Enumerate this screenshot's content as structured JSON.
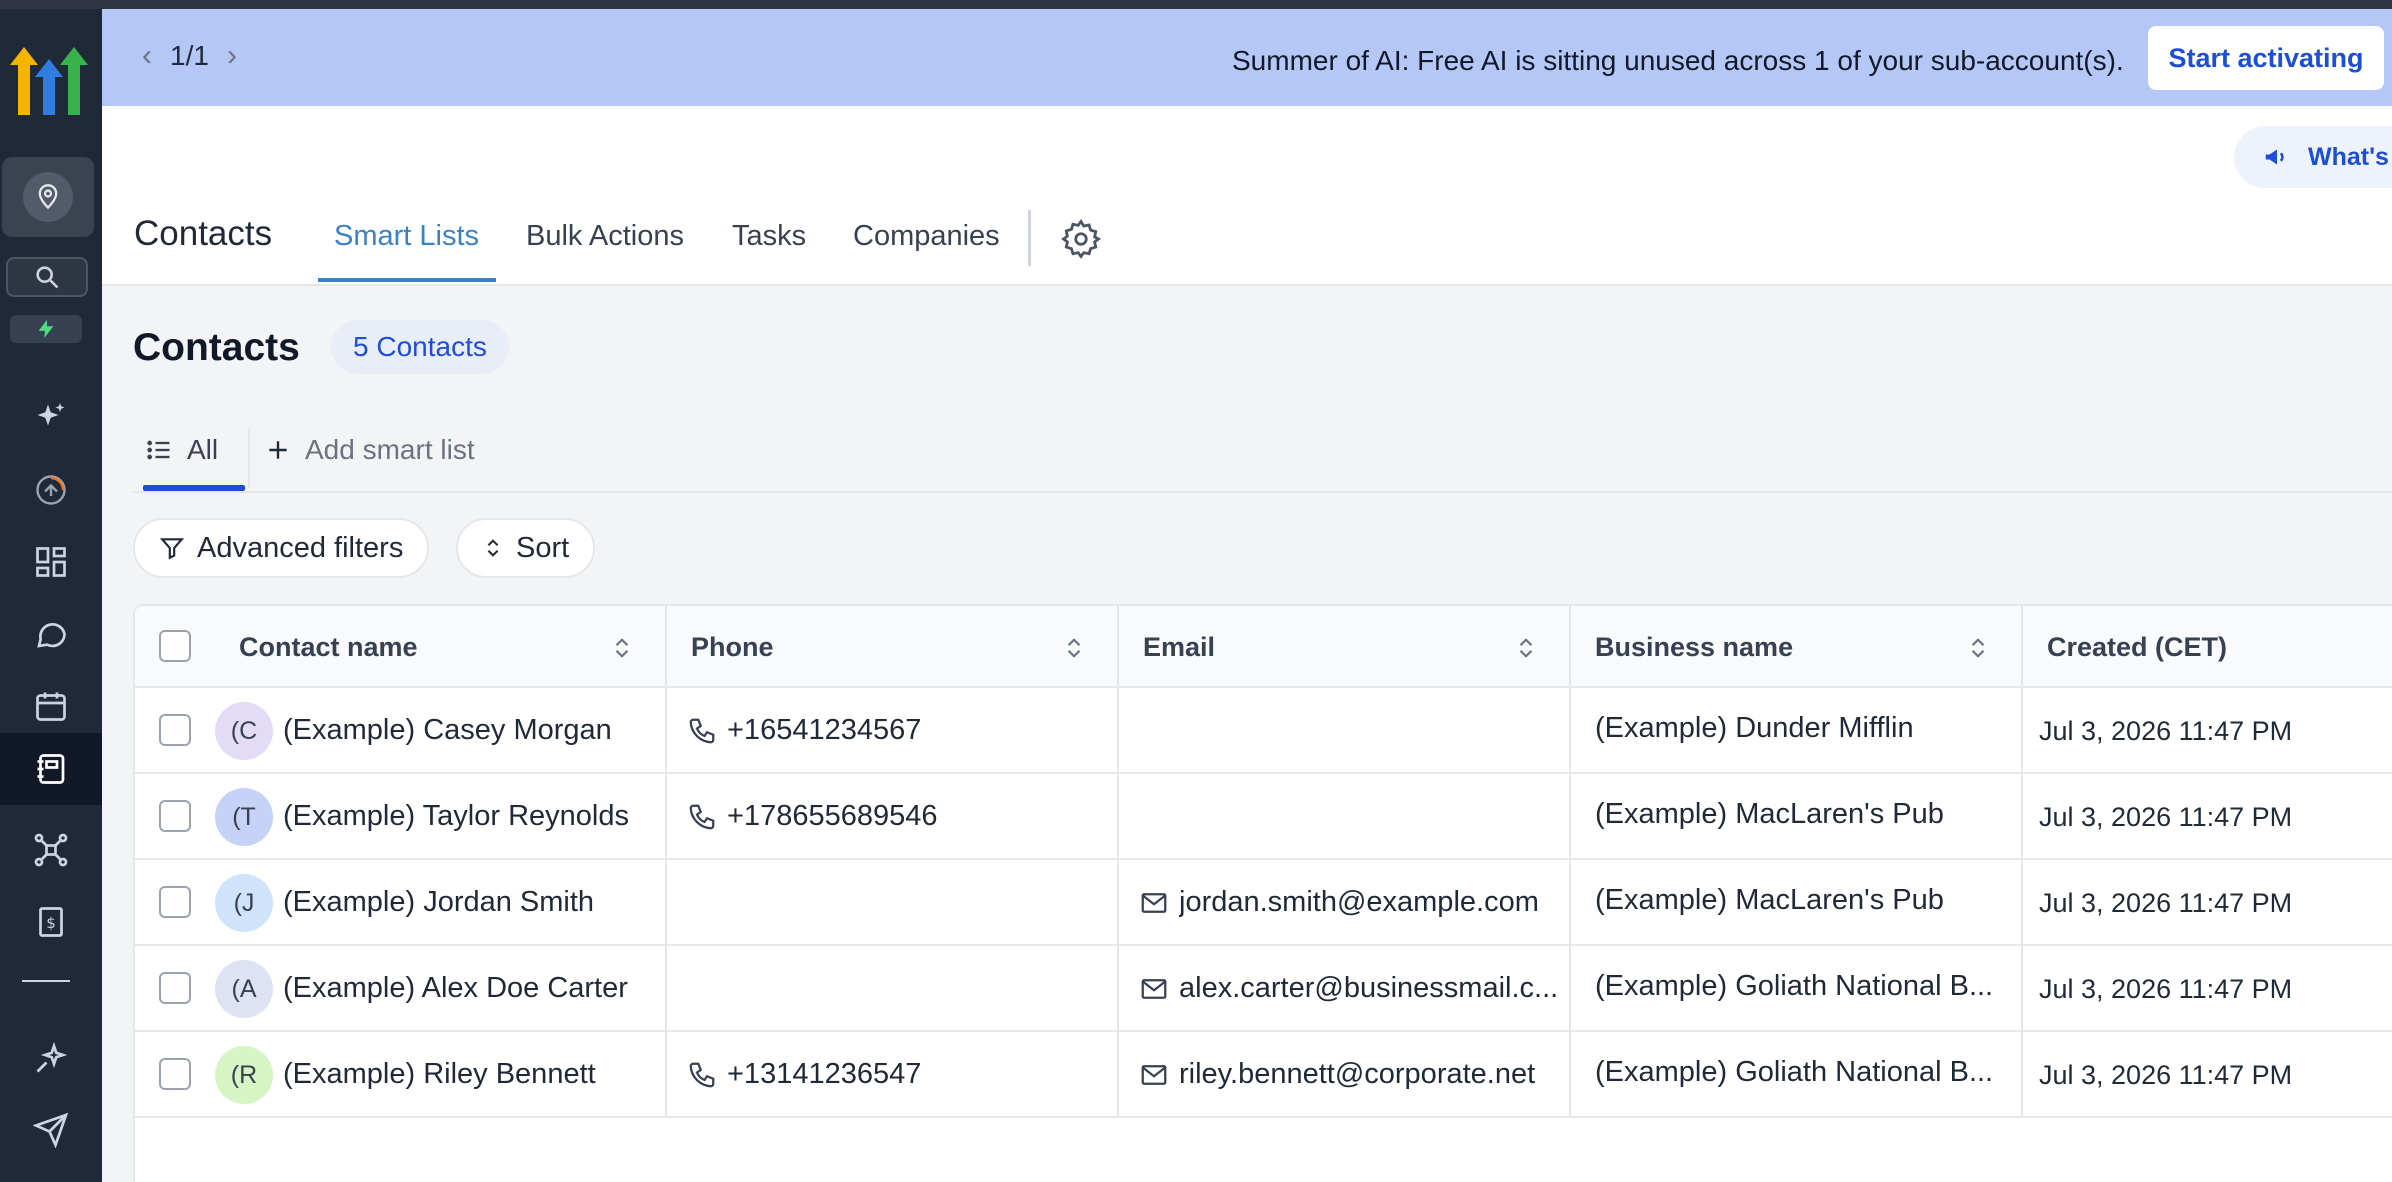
{
  "banner": {
    "pager_text": "1/1",
    "message": "Summer of AI: Free AI is sitting unused across 1 of your sub-account(s).",
    "cta_label": "Start activating"
  },
  "header": {
    "whats_new_label": "What's",
    "title": "Contacts",
    "tabs": [
      {
        "label": "Smart Lists",
        "active": true
      },
      {
        "label": "Bulk Actions",
        "active": false
      },
      {
        "label": "Tasks",
        "active": false
      },
      {
        "label": "Companies",
        "active": false
      }
    ]
  },
  "section": {
    "title": "Contacts",
    "count_badge": "5 Contacts"
  },
  "smart_lists": {
    "all_label": "All",
    "add_label": "Add smart list"
  },
  "toolbar": {
    "filters_label": "Advanced filters",
    "sort_label": "Sort"
  },
  "table": {
    "columns": [
      "Contact name",
      "Phone",
      "Email",
      "Business name",
      "Created (CET)"
    ],
    "rows": [
      {
        "initials": "(C",
        "name": "(Example) Casey Morgan",
        "phone": "+16541234567",
        "email": "",
        "business": "(Example) Dunder Mifflin",
        "created": "Jul 3, 2026 11:47 PM",
        "avatar_color": "#e4dcf7"
      },
      {
        "initials": "(T",
        "name": "(Example) Taylor Reynolds",
        "phone": "+178655689546",
        "email": "",
        "business": "(Example) MacLaren's Pub",
        "created": "Jul 3, 2026 11:47 PM",
        "avatar_color": "#c7d2f7"
      },
      {
        "initials": "(J",
        "name": "(Example) Jordan Smith",
        "phone": "",
        "email": "jordan.smith@example.com",
        "business": "(Example) MacLaren's Pub",
        "created": "Jul 3, 2026 11:47 PM",
        "avatar_color": "#cfe3fa"
      },
      {
        "initials": "(A",
        "name": "(Example) Alex Doe Carter",
        "phone": "",
        "email": "alex.carter@businessmail.c...",
        "business": "(Example) Goliath National B...",
        "created": "Jul 3, 2026 11:47 PM",
        "avatar_color": "#dde3f3"
      },
      {
        "initials": "(R",
        "name": "(Example) Riley Bennett",
        "phone": "+13141236547",
        "email": "riley.bennett@corporate.net",
        "business": "(Example) Goliath National B...",
        "created": "Jul 3, 2026 11:47 PM",
        "avatar_color": "#d6f5c4"
      }
    ]
  },
  "colors": {
    "banner_bg": "#b5c7f7",
    "accent_blue": "#1d4ed8",
    "sidebar_bg": "#1f2937"
  }
}
